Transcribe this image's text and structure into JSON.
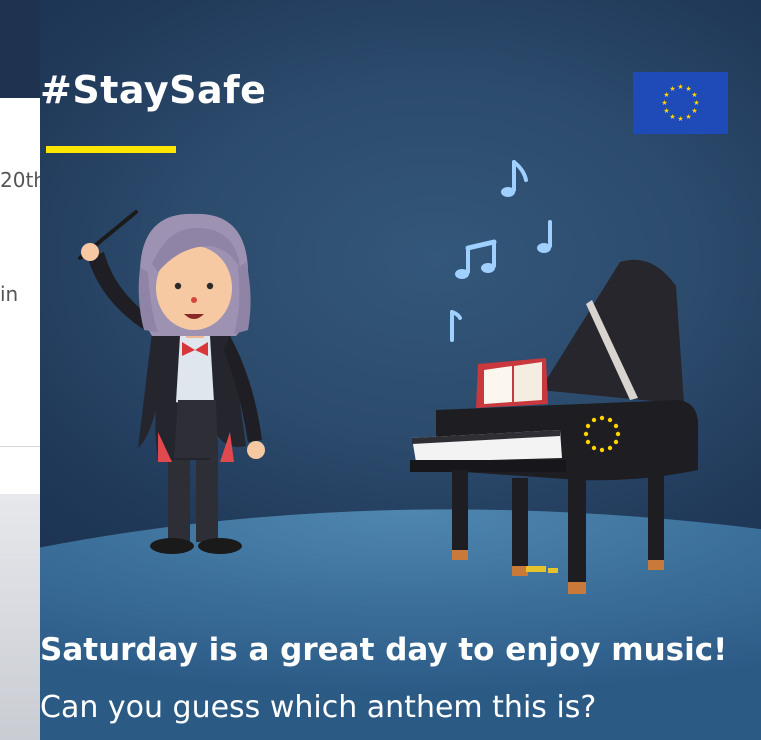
{
  "background_page": {
    "text_fragment_1": "20th",
    "text_fragment_2": "in"
  },
  "post": {
    "hashtag": "#StaySafe",
    "headline": "Saturday is a great day to enjoy music!",
    "subline": "Can you guess which anthem this is?",
    "flag_icon": "eu-flag-icon",
    "colors": {
      "background": "#2c4b6d",
      "accent_underline": "#ffe600",
      "flag_blue": "#1e4bb8",
      "flag_stars": "#ffd500"
    }
  }
}
